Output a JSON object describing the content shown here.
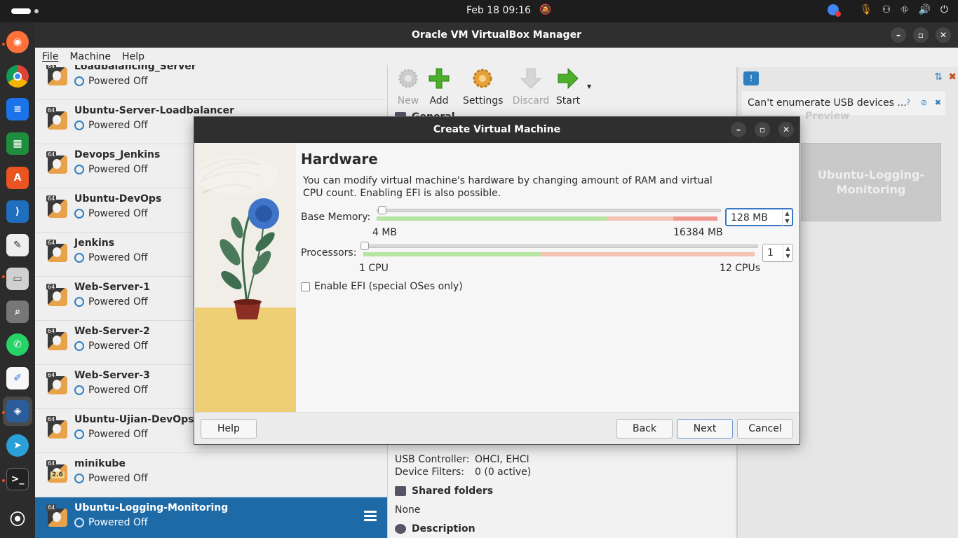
{
  "topbar": {
    "clock": "Feb 18  09:16"
  },
  "vbox": {
    "title": "Oracle VM VirtualBox Manager",
    "menu": [
      "File",
      "Machine",
      "Help"
    ],
    "toolbar": {
      "new": "New",
      "add": "Add",
      "settings": "Settings",
      "discard": "Discard",
      "start": "Start"
    },
    "vms": [
      {
        "name": "Loadbalancing_Server",
        "state": "Powered Off",
        "version": "64"
      },
      {
        "name": "Ubuntu-Server-Loadbalancer",
        "state": "Powered Off",
        "version": "64"
      },
      {
        "name": "Devops_Jenkins",
        "state": "Powered Off",
        "version": "64"
      },
      {
        "name": "Ubuntu-DevOps",
        "state": "Powered Off",
        "version": "64"
      },
      {
        "name": "Jenkins",
        "state": "Powered Off",
        "version": "64"
      },
      {
        "name": "Web-Server-1",
        "state": "Powered Off",
        "version": "64"
      },
      {
        "name": "Web-Server-2",
        "state": "Powered Off",
        "version": "64"
      },
      {
        "name": "Web-Server-3",
        "state": "Powered Off",
        "version": "64"
      },
      {
        "name": "Ubuntu-Ujian-DevOps-Cl",
        "state": "Powered Off",
        "version": "64"
      },
      {
        "name": "minikube",
        "state": "Powered Off",
        "version": "64",
        "sub": "2.6"
      },
      {
        "name": "Ubuntu-Logging-Monitoring",
        "state": "Powered Off",
        "version": "64",
        "selected": true
      }
    ],
    "details": {
      "general_head": "General",
      "usb_controller_label": "USB Controller:",
      "usb_controller_value": "OHCI, EHCI",
      "device_filters_label": "Device Filters:",
      "device_filters_value": "0 (0 active)",
      "shared_folders_head": "Shared folders",
      "shared_folders_value": "None",
      "description_head": "Description"
    },
    "notice": "Can't enumerate USB devices ...",
    "preview_head": "Preview",
    "preview_name": "Ubuntu-Logging-Monitoring"
  },
  "dialog": {
    "title": "Create Virtual Machine",
    "heading": "Hardware",
    "description": "You can modify virtual machine's hardware by changing amount of RAM and virtual CPU count. Enabling EFI is also possible.",
    "memory": {
      "label": "Base Memory:",
      "value": "128 MB",
      "min_label": "4 MB",
      "max_label": "16384 MB",
      "level": 0.008
    },
    "processors": {
      "label": "Processors:",
      "value": "1",
      "min_label": "1 CPU",
      "max_label": "12 CPUs",
      "level": 0
    },
    "efi_label": "Enable EFI (special OSes only)",
    "efi_checked": false,
    "buttons": {
      "help": "Help",
      "back": "Back",
      "next": "Next",
      "cancel": "Cancel"
    }
  }
}
